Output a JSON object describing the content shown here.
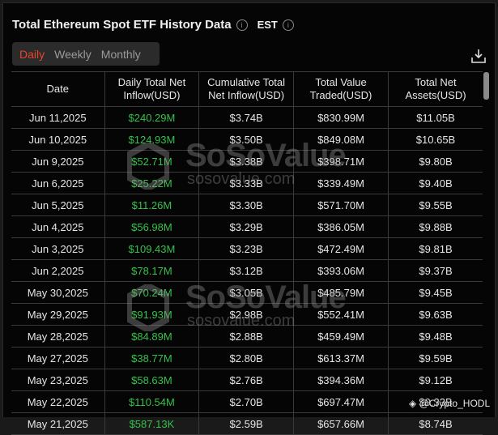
{
  "title": "Total Ethereum Spot ETF History Data",
  "timezone": "EST",
  "tabs": [
    {
      "label": "Daily",
      "active": true
    },
    {
      "label": "Weekly",
      "active": false
    },
    {
      "label": "Monthly",
      "active": false
    }
  ],
  "columns": [
    "Date",
    "Daily Total Net Inflow(USD)",
    "Cumulative Total Net Inflow(USD)",
    "Total Value Traded(USD)",
    "Total Net Assets(USD)"
  ],
  "rows": [
    [
      "Jun 11,2025",
      "$240.29M",
      "$3.74B",
      "$830.99M",
      "$11.05B"
    ],
    [
      "Jun 10,2025",
      "$124.93M",
      "$3.50B",
      "$849.08M",
      "$10.65B"
    ],
    [
      "Jun 9,2025",
      "$52.71M",
      "$3.38B",
      "$398.71M",
      "$9.80B"
    ],
    [
      "Jun 6,2025",
      "$25.22M",
      "$3.33B",
      "$339.49M",
      "$9.40B"
    ],
    [
      "Jun 5,2025",
      "$11.26M",
      "$3.30B",
      "$571.70M",
      "$9.55B"
    ],
    [
      "Jun 4,2025",
      "$56.98M",
      "$3.29B",
      "$386.05M",
      "$9.88B"
    ],
    [
      "Jun 3,2025",
      "$109.43M",
      "$3.23B",
      "$472.49M",
      "$9.81B"
    ],
    [
      "Jun 2,2025",
      "$78.17M",
      "$3.12B",
      "$393.06M",
      "$9.37B"
    ],
    [
      "May 30,2025",
      "$70.24M",
      "$3.05B",
      "$485.79M",
      "$9.45B"
    ],
    [
      "May 29,2025",
      "$91.93M",
      "$2.98B",
      "$552.41M",
      "$9.63B"
    ],
    [
      "May 28,2025",
      "$84.89M",
      "$2.88B",
      "$459.49M",
      "$9.48B"
    ],
    [
      "May 27,2025",
      "$38.77M",
      "$2.80B",
      "$613.37M",
      "$9.59B"
    ],
    [
      "May 23,2025",
      "$58.63M",
      "$2.76B",
      "$394.36M",
      "$9.12B"
    ],
    [
      "May 22,2025",
      "$110.54M",
      "$2.70B",
      "$697.47M",
      "$9.33B"
    ],
    [
      "May 21,2025",
      "$587.13K",
      "$2.59B",
      "$657.66M",
      "$8.74B"
    ]
  ],
  "watermark": {
    "brand": "SoSoValue",
    "site": "sosovalue.com"
  },
  "credit": "@Crypto_HODL",
  "colors": {
    "accent": "#e8452c",
    "positive": "#35c14a"
  }
}
